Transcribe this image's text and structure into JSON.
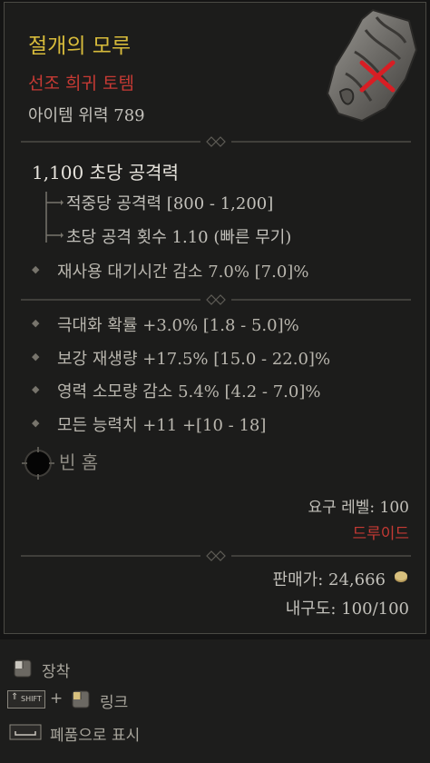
{
  "item": {
    "name": "절개의 모루",
    "type": "선조 희귀 토템",
    "item_power": "아이템 위력 789",
    "dps": "1,100 초당 공격력",
    "damage_per_hit": "적중당 공격력 [800 - 1,200]",
    "attacks_per_second": "초당 공격 횟수 1.10 (빠른 무기)",
    "implicit": "재사용 대기시간 감소 7.0% [7.0]%",
    "affixes": [
      "극대화 확률 +3.0% [1.8 - 5.0]%",
      "보강 재생량 +17.5% [15.0 - 22.0]%",
      "영력 소모량 감소 5.4% [4.2 - 7.0]%",
      "모든 능력치 +11 +[10 - 18]"
    ],
    "socket": "빈 홈",
    "required_level": "요구 레벨: 100",
    "class": "드루이드",
    "sell_value": "판매가: 24,666",
    "durability": "내구도: 100/100"
  },
  "actions": {
    "equip": "장착",
    "shift_key": "SHIFT",
    "plus": "+",
    "link": "링크",
    "mark_junk": "폐품으로 표시"
  },
  "colors": {
    "title": "#d7bb3b",
    "rarity": "#c63a34",
    "class_requirement": "#c63a34"
  }
}
